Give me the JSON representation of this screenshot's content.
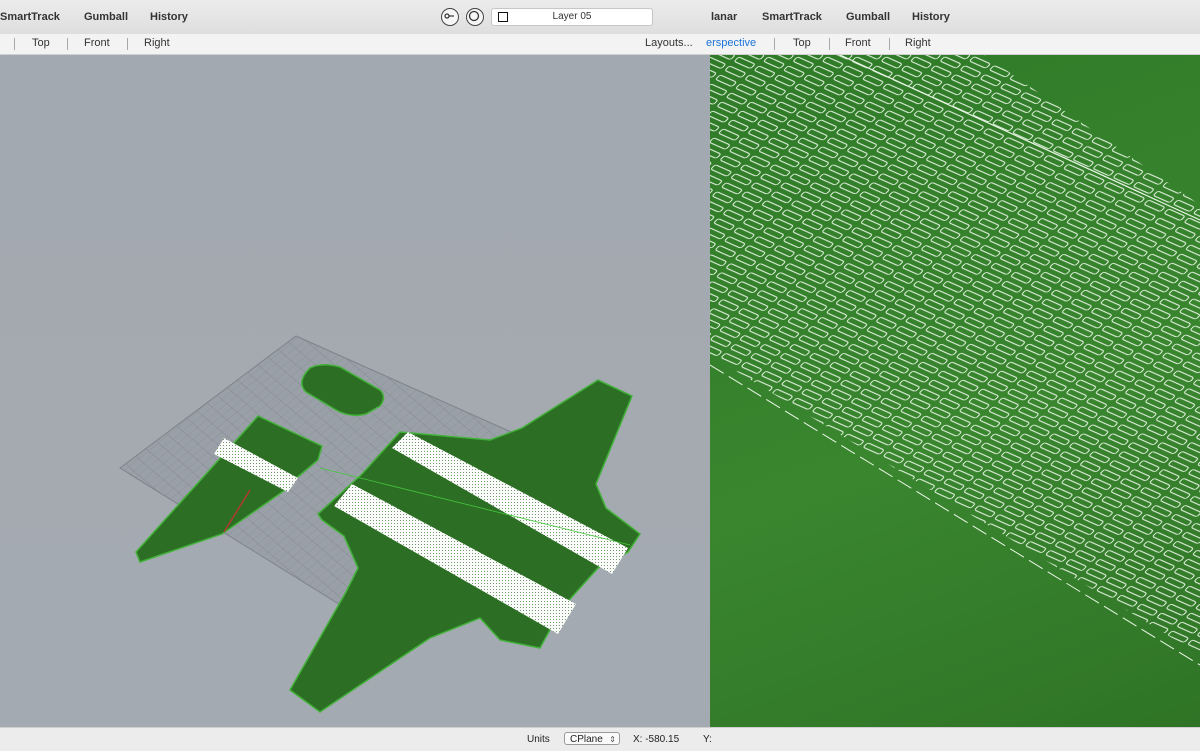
{
  "topbar": {
    "left_items": [
      "SmartTrack",
      "Gumball",
      "History"
    ],
    "right_items": [
      "lanar",
      "SmartTrack",
      "Gumball",
      "History"
    ],
    "layer": "Layer 05"
  },
  "tabbar": {
    "left_tabs": [
      "Top",
      "Front",
      "Right"
    ],
    "layouts": "Layouts...",
    "active_tab": "erspective",
    "right_tabs": [
      "Top",
      "Front",
      "Right"
    ]
  },
  "statusbar": {
    "units_label": "Units",
    "cplane": "CPlane",
    "x_readout": "X: -580.15",
    "y_label": "Y:"
  },
  "colors": {
    "accent": "#1b73d9",
    "model_green": "#2b7a24",
    "viewport_gray": "#a3a9b0"
  }
}
